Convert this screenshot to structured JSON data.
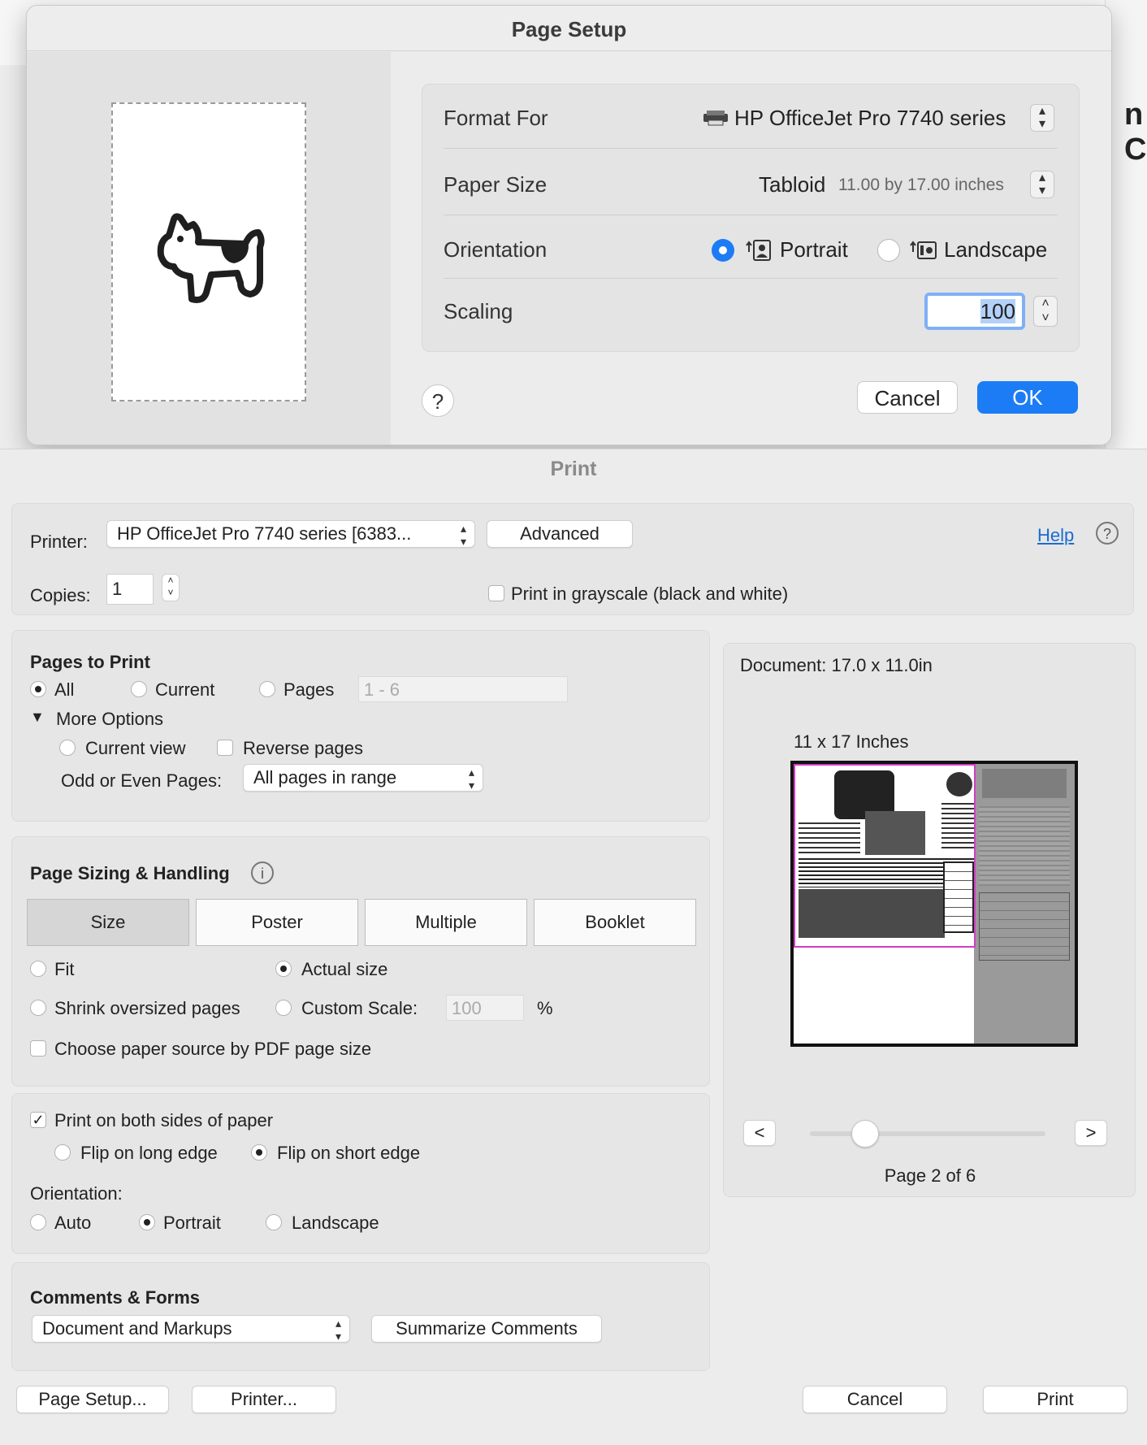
{
  "background": {
    "right_text": "n Ca"
  },
  "page_setup": {
    "title": "Page Setup",
    "format_for_label": "Format For",
    "format_for_value": "HP OfficeJet Pro 7740 series",
    "paper_size_label": "Paper Size",
    "paper_size_value": "Tabloid",
    "paper_size_dims": "11.00 by 17.00 inches",
    "orientation_label": "Orientation",
    "orientation_portrait": "Portrait",
    "orientation_landscape": "Landscape",
    "orientation_selected": "Portrait",
    "scaling_label": "Scaling",
    "scaling_value": "100",
    "help": "?",
    "cancel": "Cancel",
    "ok": "OK"
  },
  "print": {
    "title": "Print",
    "printer_label": "Printer:",
    "printer_value": "HP OfficeJet Pro 7740 series [6383...",
    "advanced": "Advanced",
    "help_link": "Help",
    "help_icon": "?",
    "copies_label": "Copies:",
    "copies_value": "1",
    "grayscale": "Print in grayscale (black and white)",
    "pages_to_print": {
      "header": "Pages to Print",
      "all": "All",
      "current": "Current",
      "pages": "Pages",
      "pages_range": "1 - 6",
      "more_options": "More Options",
      "current_view": "Current view",
      "reverse_pages": "Reverse pages",
      "odd_even_label": "Odd or Even Pages:",
      "odd_even_value": "All pages in range"
    },
    "sizing": {
      "header": "Page Sizing & Handling",
      "info_icon": "i",
      "tabs": [
        "Size",
        "Poster",
        "Multiple",
        "Booklet"
      ],
      "selected_tab": "Size",
      "fit": "Fit",
      "actual_size": "Actual size",
      "shrink": "Shrink oversized pages",
      "custom_scale": "Custom Scale:",
      "custom_scale_value": "100",
      "percent": "%",
      "paper_source": "Choose paper source by PDF page size"
    },
    "duplex": {
      "both_sides": "Print on both sides of paper",
      "long_edge": "Flip on long edge",
      "short_edge": "Flip on short edge",
      "orientation_label": "Orientation:",
      "auto": "Auto",
      "portrait": "Portrait",
      "landscape": "Landscape"
    },
    "comments": {
      "header": "Comments & Forms",
      "value": "Document and Markups",
      "summarize": "Summarize Comments"
    },
    "preview": {
      "document_size": "Document: 17.0 x 11.0in",
      "paper_label": "11 x 17 Inches",
      "prev": "<",
      "next": ">",
      "page_status": "Page 2 of 6",
      "current_page": 2,
      "total_pages": 6
    },
    "page_setup_btn": "Page Setup...",
    "printer_btn": "Printer...",
    "cancel": "Cancel",
    "print_btn": "Print"
  }
}
